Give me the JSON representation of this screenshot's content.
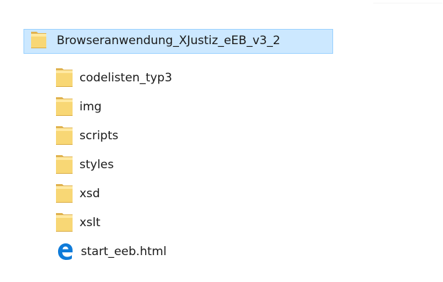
{
  "tree": {
    "root": {
      "label": "Browseranwendung_XJustiz_eEB_v3_2",
      "icon": "folder-icon",
      "selected": true
    },
    "children": [
      {
        "label": "codelisten_typ3",
        "icon": "folder-icon"
      },
      {
        "label": "img",
        "icon": "folder-icon"
      },
      {
        "label": "scripts",
        "icon": "folder-icon"
      },
      {
        "label": "styles",
        "icon": "folder-icon"
      },
      {
        "label": "xsd",
        "icon": "folder-icon"
      },
      {
        "label": "xslt",
        "icon": "folder-icon"
      },
      {
        "label": "start_eeb.html",
        "icon": "edge-html-file-icon"
      }
    ]
  },
  "colors": {
    "selection_background": "#cce8ff",
    "selection_border": "#99d1ff",
    "folder_yellow": "#f8d775",
    "folder_yellow_light": "#ffe9a2",
    "edge_blue": "#0f7bd9"
  }
}
